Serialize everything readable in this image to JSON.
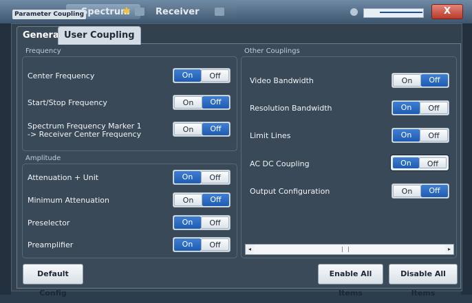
{
  "background": {
    "dialog_title": "Parameter Coupling",
    "tabs": [
      "Spectrum",
      "Receiver"
    ],
    "close_label": "X"
  },
  "tabs": [
    {
      "label": "General",
      "active": true
    },
    {
      "label": "User Coupling",
      "active": false
    }
  ],
  "frequency": {
    "title": "Frequency",
    "rows": [
      {
        "label": "Center Frequency",
        "state": "On"
      },
      {
        "label": "Start/Stop Frequency",
        "state": "Off"
      },
      {
        "label": "Spectrum Frequency Marker 1",
        "label2": "-> Receiver Center Frequency",
        "state": "Off"
      }
    ]
  },
  "amplitude": {
    "title": "Amplitude",
    "rows": [
      {
        "label": "Attenuation + Unit",
        "state": "On"
      },
      {
        "label": "Minimum Attenuation",
        "state": "Off"
      },
      {
        "label": "Preselector",
        "state": "On"
      },
      {
        "label": "Preamplifier",
        "state": "On"
      }
    ]
  },
  "other": {
    "title": "Other Couplings",
    "rows": [
      {
        "label": "Video Bandwidth",
        "state": "Off"
      },
      {
        "label": "Resolution Bandwidth",
        "state": "On"
      },
      {
        "label": "Limit Lines",
        "state": "On"
      },
      {
        "label": "AC DC Coupling",
        "state": "On"
      },
      {
        "label": "Output Configuration",
        "state": "Off"
      }
    ]
  },
  "toggle": {
    "on": "On",
    "off": "Off"
  },
  "buttons": {
    "default_config": "Default Config",
    "enable_all": "Enable All Items",
    "disable_all": "Disable All Items"
  },
  "colors": {
    "accent": "#2a67bf",
    "panel": "#3a4a58"
  }
}
